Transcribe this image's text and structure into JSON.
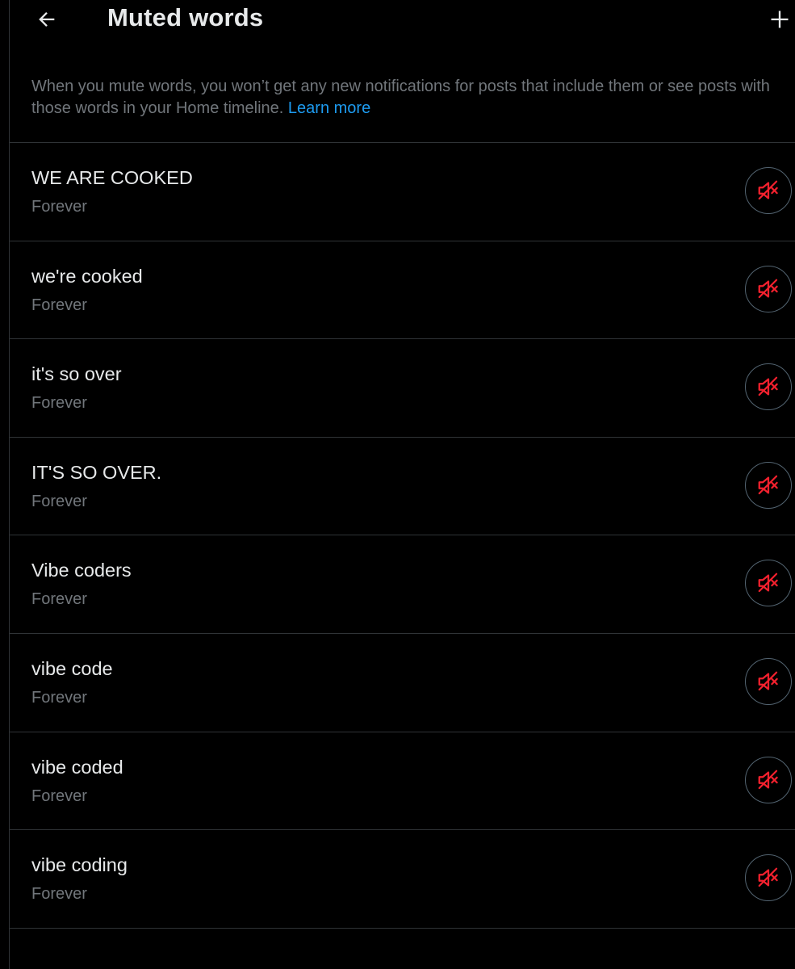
{
  "header": {
    "back_icon": "arrow-left-icon",
    "title": "Muted words",
    "add_icon": "plus-icon"
  },
  "description": {
    "text": "When you mute words, you won’t get any new notifications for posts that include them or see posts with those words in your Home timeline.",
    "link_label": "Learn more"
  },
  "colors": {
    "background": "#000000",
    "primary_text": "#e7e9ea",
    "secondary_text": "#71767b",
    "link": "#1d9bf0",
    "divider": "#2f3336",
    "unmute_icon": "#f4212e"
  },
  "muted_words": [
    {
      "word": "WE ARE COOKED",
      "duration": "Forever",
      "action_icon": "speaker-muted-icon"
    },
    {
      "word": "we're cooked",
      "duration": "Forever",
      "action_icon": "speaker-muted-icon"
    },
    {
      "word": "it's so over",
      "duration": "Forever",
      "action_icon": "speaker-muted-icon"
    },
    {
      "word": "IT'S SO OVER.",
      "duration": "Forever",
      "action_icon": "speaker-muted-icon"
    },
    {
      "word": "Vibe coders",
      "duration": "Forever",
      "action_icon": "speaker-muted-icon"
    },
    {
      "word": "vibe code",
      "duration": "Forever",
      "action_icon": "speaker-muted-icon"
    },
    {
      "word": "vibe coded",
      "duration": "Forever",
      "action_icon": "speaker-muted-icon"
    },
    {
      "word": "vibe coding",
      "duration": "Forever",
      "action_icon": "speaker-muted-icon"
    }
  ]
}
